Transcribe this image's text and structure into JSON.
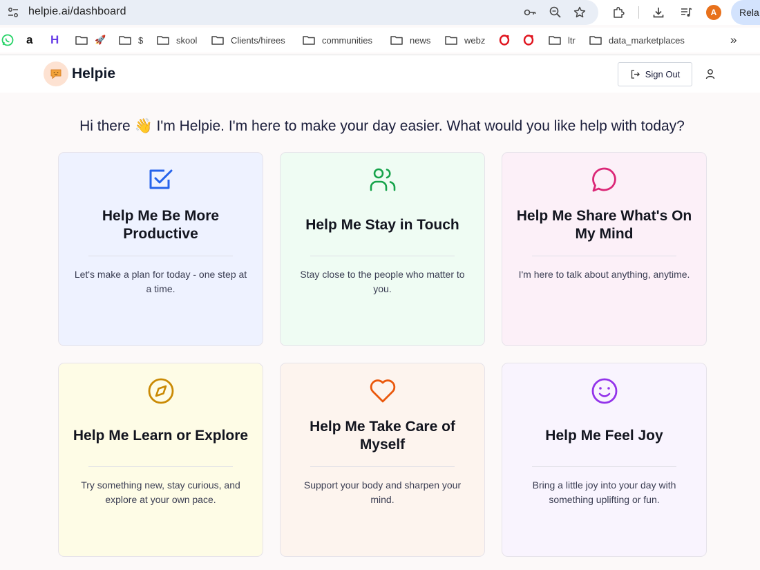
{
  "browser": {
    "url": "helpie.ai/dashboard",
    "avatar_letter": "A",
    "relaunch_label": "Rela",
    "bookmarks": [
      {
        "label": "",
        "icon": "whatsapp-icon"
      },
      {
        "label": "a",
        "icon": "amazon-icon"
      },
      {
        "label": "H",
        "icon": "hostinger-icon"
      },
      {
        "label": "🚀",
        "icon": "folder-icon"
      },
      {
        "label": "$",
        "icon": "folder-icon"
      },
      {
        "label": "skool",
        "icon": "folder-icon"
      },
      {
        "label": "Clients/hirees",
        "icon": "folder-icon"
      },
      {
        "label": "communities",
        "icon": "folder-icon"
      },
      {
        "label": "news",
        "icon": "folder-icon"
      },
      {
        "label": "webz",
        "icon": "folder-icon"
      },
      {
        "label": "",
        "icon": "opera-icon"
      },
      {
        "label": "",
        "icon": "opera-icon"
      },
      {
        "label": "ltr",
        "icon": "folder-icon"
      },
      {
        "label": "data_marketplaces",
        "icon": "folder-icon"
      }
    ],
    "overflow_label": "»"
  },
  "header": {
    "brand": "Helpie",
    "sign_out_label": "Sign Out"
  },
  "main": {
    "greeting": "Hi there 👋 I'm Helpie. I'm here to make your day easier. What would you like help with today?",
    "cards": [
      {
        "title": "Help Me Be More Productive",
        "description": "Let's make a plan for today - one step at a time.",
        "icon": "checkbox-icon",
        "color": "#2563eb"
      },
      {
        "title": "Help Me Stay in Touch",
        "description": "Stay close to the people who matter to you.",
        "icon": "users-icon",
        "color": "#16a34a"
      },
      {
        "title": "Help Me Share What's On My Mind",
        "description": "I'm here to talk about anything, anytime.",
        "icon": "chat-bubble-icon",
        "color": "#db2777"
      },
      {
        "title": "Help Me Learn or Explore",
        "description": "Try something new, stay curious, and explore at your own pace.",
        "icon": "compass-icon",
        "color": "#ca8a04"
      },
      {
        "title": "Help Me Take Care of Myself",
        "description": "Support your body and sharpen your mind.",
        "icon": "heart-icon",
        "color": "#ea580c"
      },
      {
        "title": "Help Me Feel Joy",
        "description": "Bring a little joy into your day with something uplifting or fun.",
        "icon": "smiley-icon",
        "color": "#9333ea"
      }
    ]
  }
}
